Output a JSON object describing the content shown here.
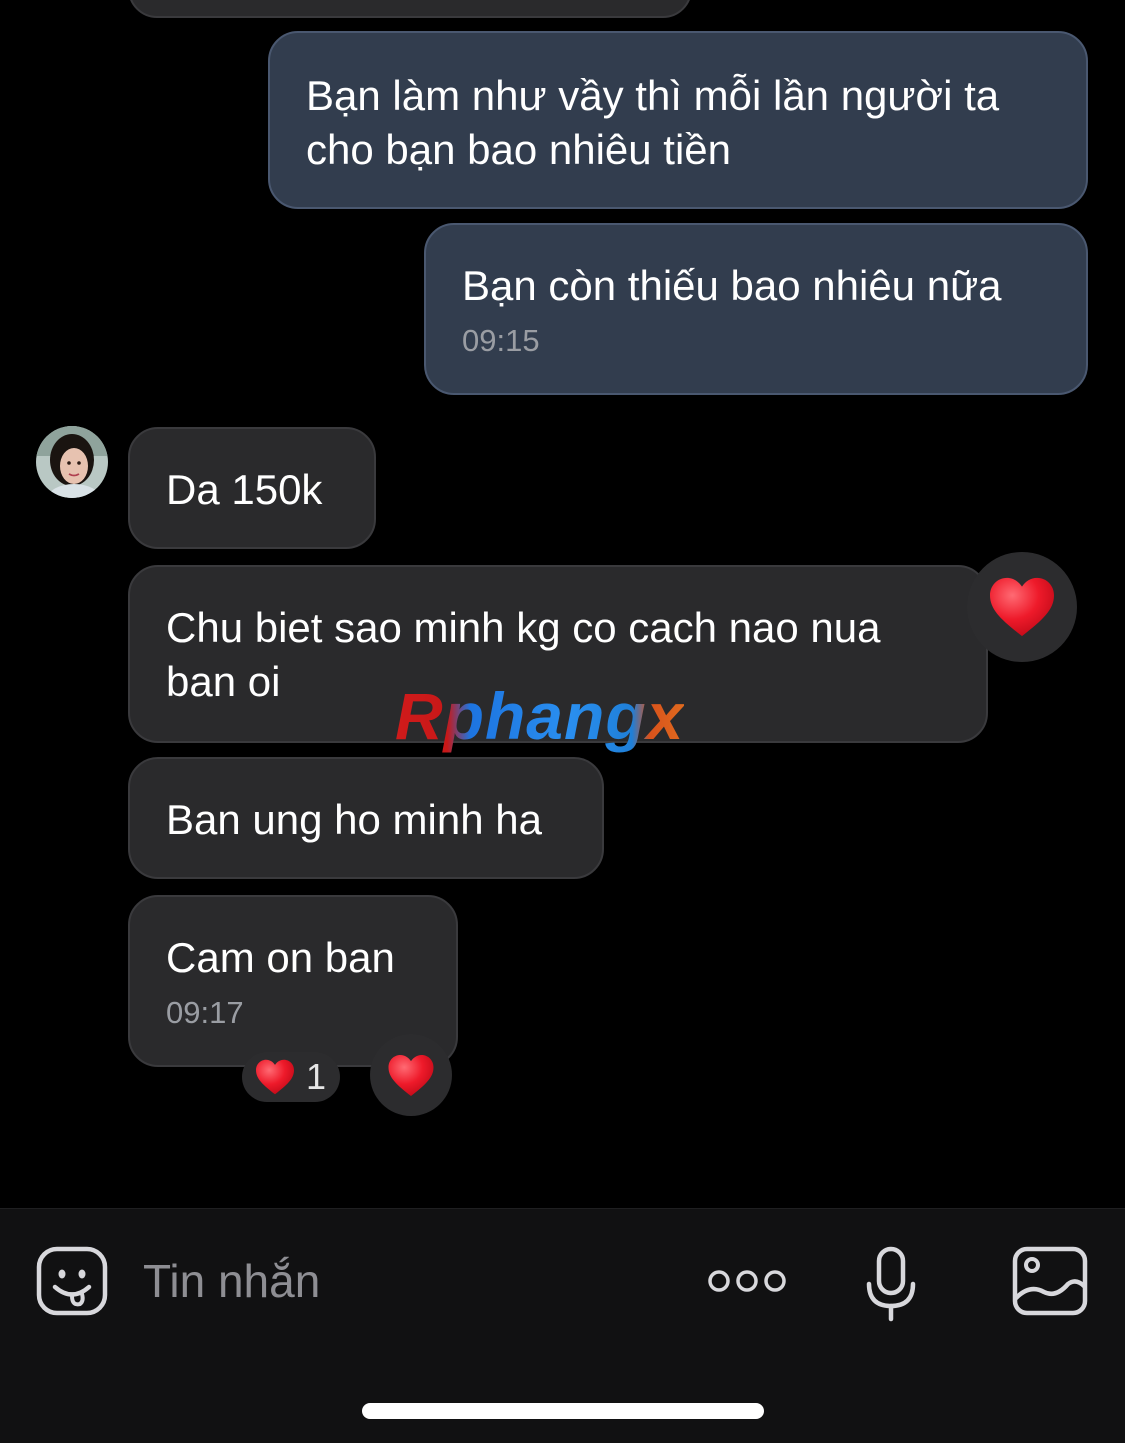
{
  "messages": [
    {
      "text": "Bạn làm như vầy thì mỗi lần người ta cho bạn bao nhiêu tiền"
    },
    {
      "text": "Bạn còn thiếu bao nhiêu nữa",
      "time": "09:15"
    },
    {
      "text": "Da 150k"
    },
    {
      "text": "Chu biet sao minh kg co cach nao nua ban oi"
    },
    {
      "text": "Ban ung ho minh ha"
    },
    {
      "text": "Cam on ban",
      "time": "09:17",
      "reaction_count": "1"
    }
  ],
  "watermark": "Rphangx",
  "input": {
    "placeholder": "Tin nhắn"
  },
  "icons": [
    "sticker-icon",
    "more-options-icon",
    "microphone-icon",
    "gallery-icon",
    "heart-reaction-icon"
  ],
  "colors": {
    "outgoing_bubble": "#323d4e",
    "incoming_bubble": "#2a2a2c",
    "heart": "#e8101f"
  }
}
